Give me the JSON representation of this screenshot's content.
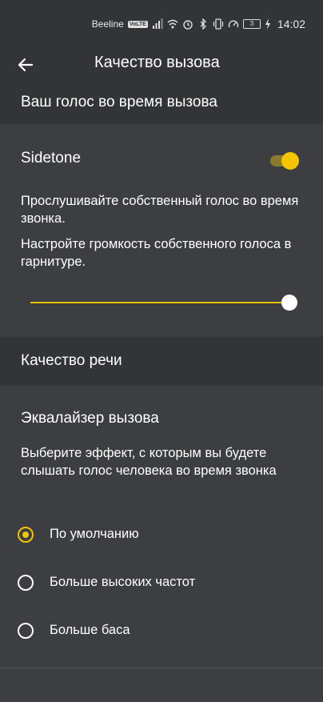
{
  "status_bar": {
    "carrier": "Beeline",
    "volte": "VoLTE",
    "battery": "3",
    "time": "14:02"
  },
  "header": {
    "title": "Качество вызова"
  },
  "voice_section": {
    "header": "Ваш голос во время вызова",
    "sidetone_label": "Sidetone",
    "sidetone_on": true,
    "description1": "Прослушивайте собственный голос во время звонка.",
    "description2": "Настройте громкость собственного голоса в гарнитуре.",
    "volume_level": 1.0
  },
  "speech_section": {
    "header": "Качество речи",
    "equalizer_label": "Эквалайзер вызова",
    "equalizer_description": "Выберите эффект, с которым вы будете слышать голос человека во время звонка",
    "options": [
      {
        "label": "По умолчанию",
        "selected": true
      },
      {
        "label": "Больше высоких частот",
        "selected": false
      },
      {
        "label": "Больше баса",
        "selected": false
      }
    ]
  },
  "colors": {
    "accent": "#f5c400",
    "background": "#3d3e41",
    "header_bg": "#333437"
  }
}
